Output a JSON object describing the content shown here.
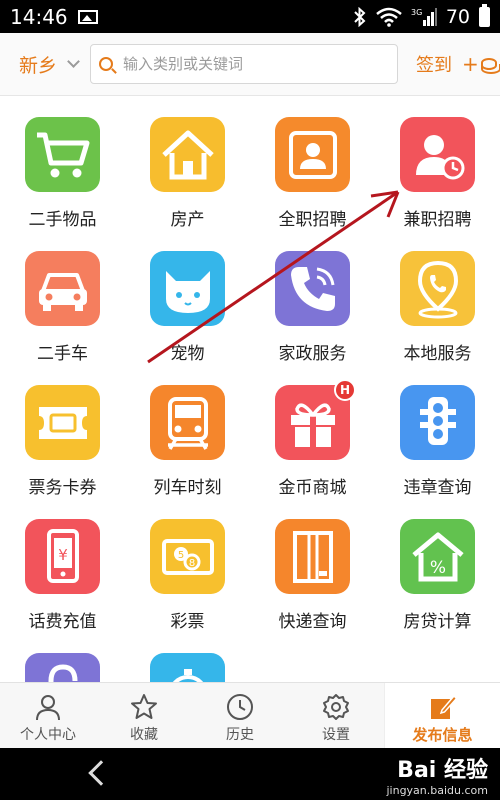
{
  "status_bar": {
    "time": "14:46",
    "battery_level": "70",
    "signal_label": "3G"
  },
  "header": {
    "city": "新乡",
    "search_placeholder": "输入类别或关键词",
    "signin": "签到",
    "signin_plus": "+"
  },
  "grid": {
    "tiles": [
      {
        "label": "二手物品",
        "icon": "shopping-cart-icon",
        "color": "#6cc24a"
      },
      {
        "label": "房产",
        "icon": "house-icon",
        "color": "#f7bd2e"
      },
      {
        "label": "全职招聘",
        "icon": "contact-card-icon",
        "color": "#f58a2c"
      },
      {
        "label": "兼职招聘",
        "icon": "person-clock-icon",
        "color": "#f2545b"
      },
      {
        "label": "二手车",
        "icon": "car-icon",
        "color": "#f57e5e"
      },
      {
        "label": "宠物",
        "icon": "cat-icon",
        "color": "#35b6ea"
      },
      {
        "label": "家政服务",
        "icon": "phone-icon",
        "color": "#7e74d6"
      },
      {
        "label": "本地服务",
        "icon": "location-phone-icon",
        "color": "#f7c23a"
      },
      {
        "label": "票务卡券",
        "icon": "ticket-icon",
        "color": "#f7c02e"
      },
      {
        "label": "列车时刻",
        "icon": "train-icon",
        "color": "#f5862c"
      },
      {
        "label": "金币商城",
        "icon": "gift-icon",
        "color": "#f2545b",
        "badge": "H"
      },
      {
        "label": "违章查询",
        "icon": "traffic-light-icon",
        "color": "#4896f0"
      },
      {
        "label": "话费充值",
        "icon": "mobile-yuan-icon",
        "color": "#f2545b"
      },
      {
        "label": "彩票",
        "icon": "lottery-icon",
        "color": "#f7c02e"
      },
      {
        "label": "快递查询",
        "icon": "package-icon",
        "color": "#f5862c"
      },
      {
        "label": "房贷计算",
        "icon": "house-percent-icon",
        "color": "#62c24f"
      },
      {
        "label": "",
        "icon": "lock-icon",
        "color": "#7e74d6"
      },
      {
        "label": "",
        "icon": "clock-top-icon",
        "color": "#35b6ea"
      }
    ]
  },
  "bottom_nav": {
    "items": [
      {
        "label": "个人中心",
        "icon": "person-icon"
      },
      {
        "label": "收藏",
        "icon": "star-icon"
      },
      {
        "label": "历史",
        "icon": "clock-icon"
      },
      {
        "label": "设置",
        "icon": "gear-icon"
      }
    ],
    "publish": "发布信息"
  },
  "watermark": {
    "logo": "Bai 经验",
    "url": "jingyan.baidu.com"
  },
  "colors": {
    "accent": "#e57b1b",
    "arrow": "#b5161e"
  }
}
